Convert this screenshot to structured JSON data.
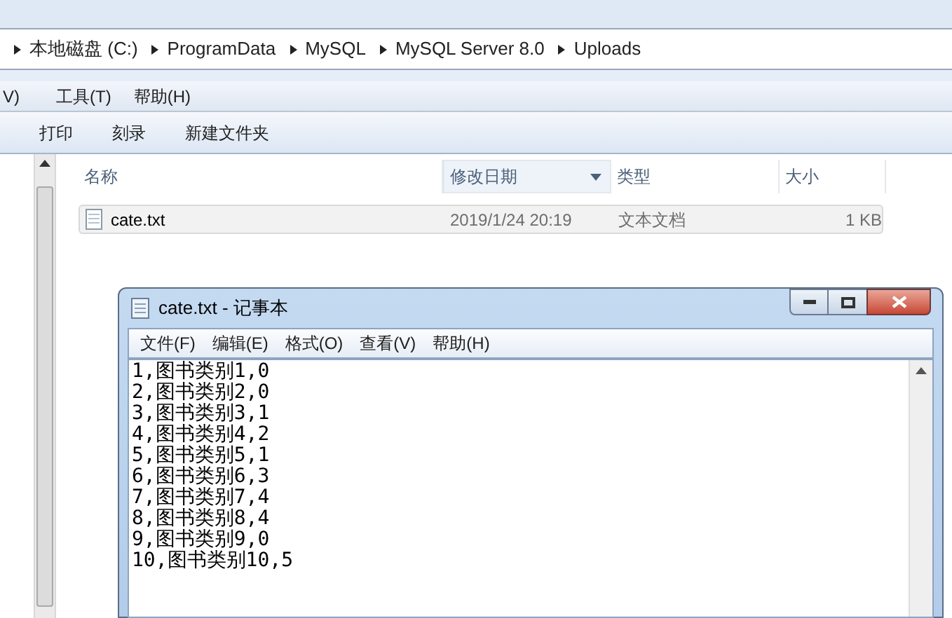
{
  "address_bar": {
    "crumbs": [
      "本地磁盘 (C:)",
      "ProgramData",
      "MySQL",
      "MySQL Server 8.0",
      "Uploads"
    ]
  },
  "menu_bar": [
    "V)",
    "工具(T)",
    "帮助(H)"
  ],
  "toolbar": [
    "打印",
    "刻录",
    "新建文件夹"
  ],
  "columns": [
    {
      "label": "名称",
      "selected": false
    },
    {
      "label": "修改日期",
      "selected": true
    },
    {
      "label": "类型",
      "selected": false
    },
    {
      "label": "大小",
      "selected": false
    }
  ],
  "files": [
    {
      "name": "cate.txt",
      "date": "2019/1/24 20:19",
      "type": "文本文档",
      "size": "1 KB",
      "selected": true
    }
  ],
  "notepad": {
    "title": "cate.txt - 记事本",
    "menu": [
      "文件(F)",
      "编辑(E)",
      "格式(O)",
      "查看(V)",
      "帮助(H)"
    ],
    "lines": [
      "1,图书类别1,0",
      "2,图书类别2,0",
      "3,图书类别3,1",
      "4,图书类别4,2",
      "5,图书类别5,1",
      "6,图书类别6,3",
      "7,图书类别7,4",
      "8,图书类别8,4",
      "9,图书类别9,0",
      "10,图书类别10,5"
    ]
  }
}
